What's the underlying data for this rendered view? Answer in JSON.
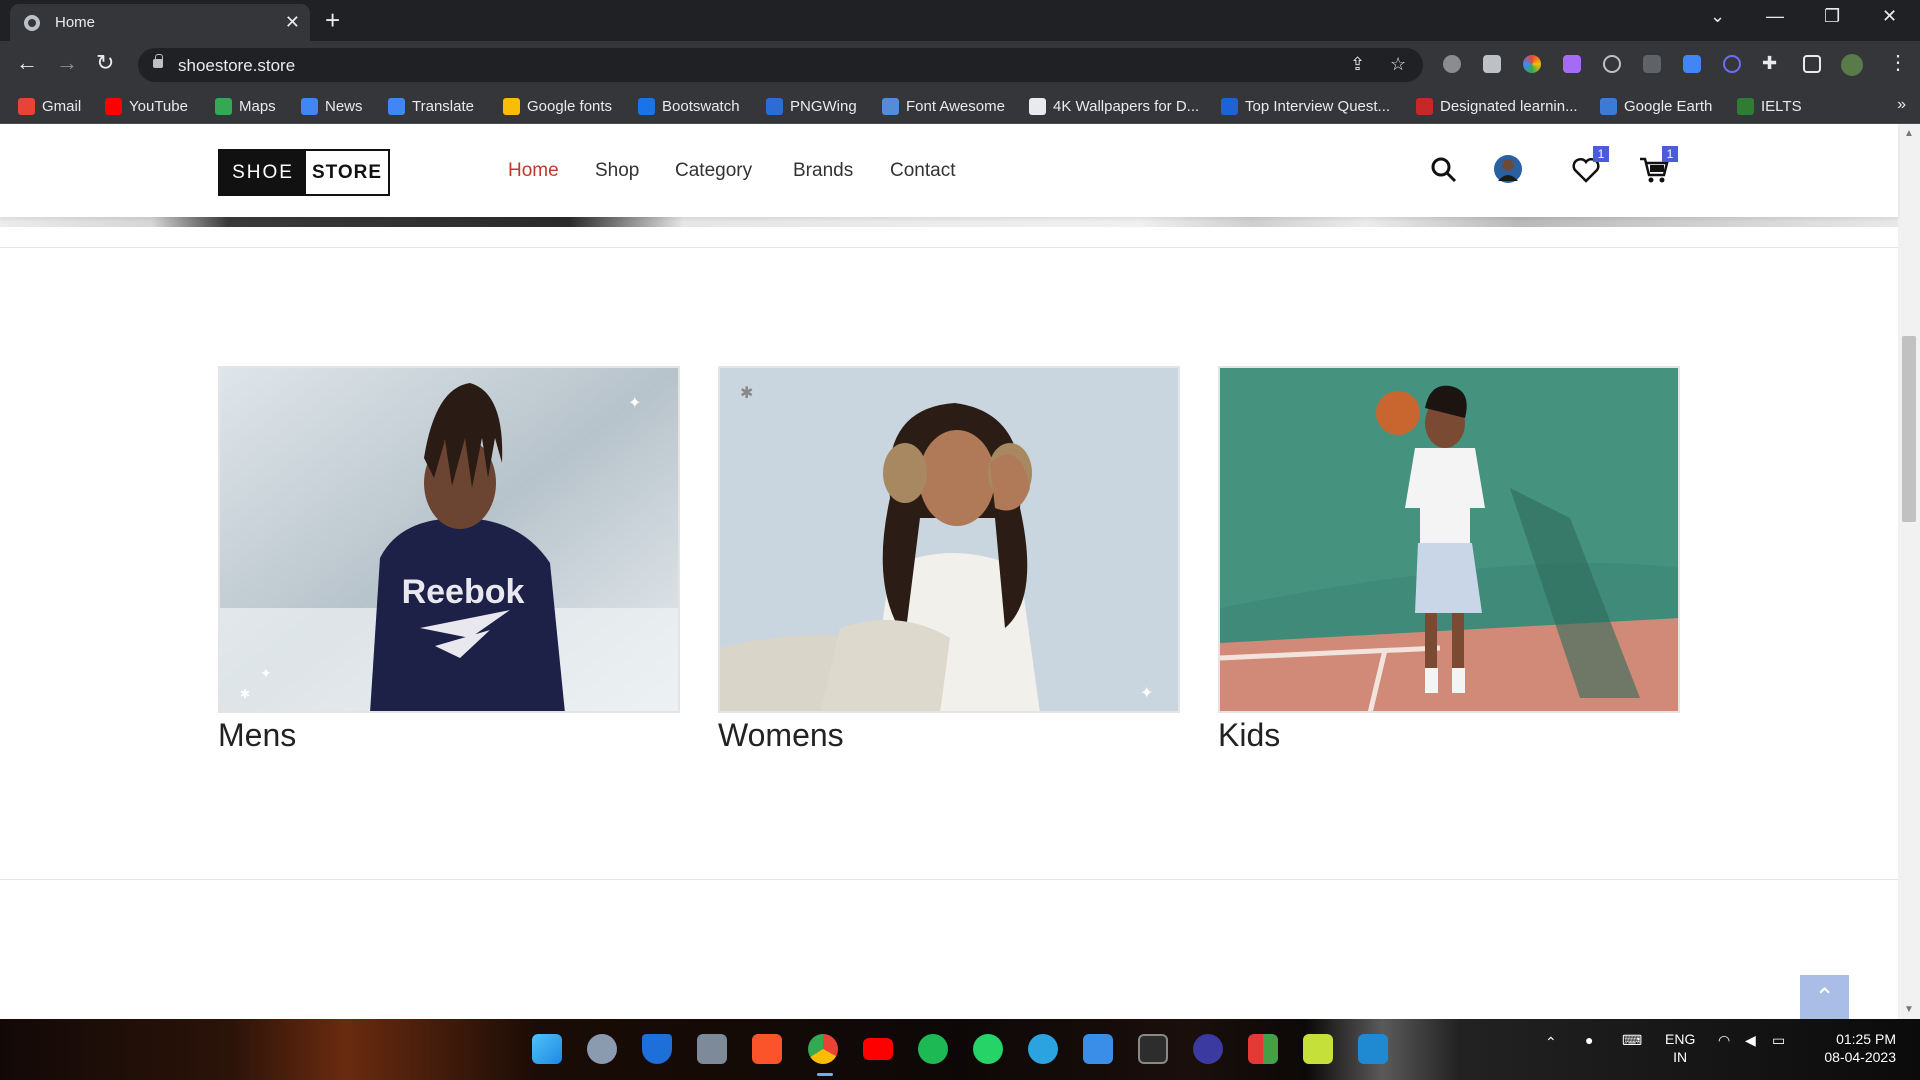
{
  "browser": {
    "tab_title": "Home",
    "tab_close": "✕",
    "new_tab": "+",
    "url": "shoestore.store",
    "window_controls": [
      "⌄",
      "—",
      "❐",
      "✕"
    ]
  },
  "bookmarks": [
    {
      "label": "Gmail",
      "color": "#ea4335"
    },
    {
      "label": "YouTube",
      "color": "#ff0000"
    },
    {
      "label": "Maps",
      "color": "#34a853"
    },
    {
      "label": "News",
      "color": "#4285f4"
    },
    {
      "label": "Translate",
      "color": "#4285f4"
    },
    {
      "label": "Google fonts",
      "color": "#fbbc04"
    },
    {
      "label": "Bootswatch",
      "color": "#1a73e8"
    },
    {
      "label": "PNGWing",
      "color": "#2b6cd6"
    },
    {
      "label": "Font Awesome",
      "color": "#538dd7"
    },
    {
      "label": "4K Wallpapers for D...",
      "color": "#e8eaed"
    },
    {
      "label": "Top Interview Quest...",
      "color": "#1e63d6"
    },
    {
      "label": "Designated learnin...",
      "color": "#c62828"
    },
    {
      "label": "Google Earth",
      "color": "#3a7bd5"
    },
    {
      "label": "IELTS",
      "color": "#2e7d32"
    }
  ],
  "bookmarks_more": "»",
  "site": {
    "logo_left": "SHOE",
    "logo_right": "STORE",
    "nav": [
      "Home",
      "Shop",
      "Category",
      "Brands",
      "Contact"
    ],
    "wishlist_count": "1",
    "cart_count": "1",
    "accent_color": "#c0392b"
  },
  "categories": [
    {
      "label": "Mens"
    },
    {
      "label": "Womens"
    },
    {
      "label": "Kids"
    }
  ],
  "mens_print": "Reebok",
  "back_to_top": "⌃",
  "taskbar": {
    "lang_top": "ENG",
    "lang_bottom": "IN",
    "time": "01:25 PM",
    "date": "08-04-2023"
  }
}
